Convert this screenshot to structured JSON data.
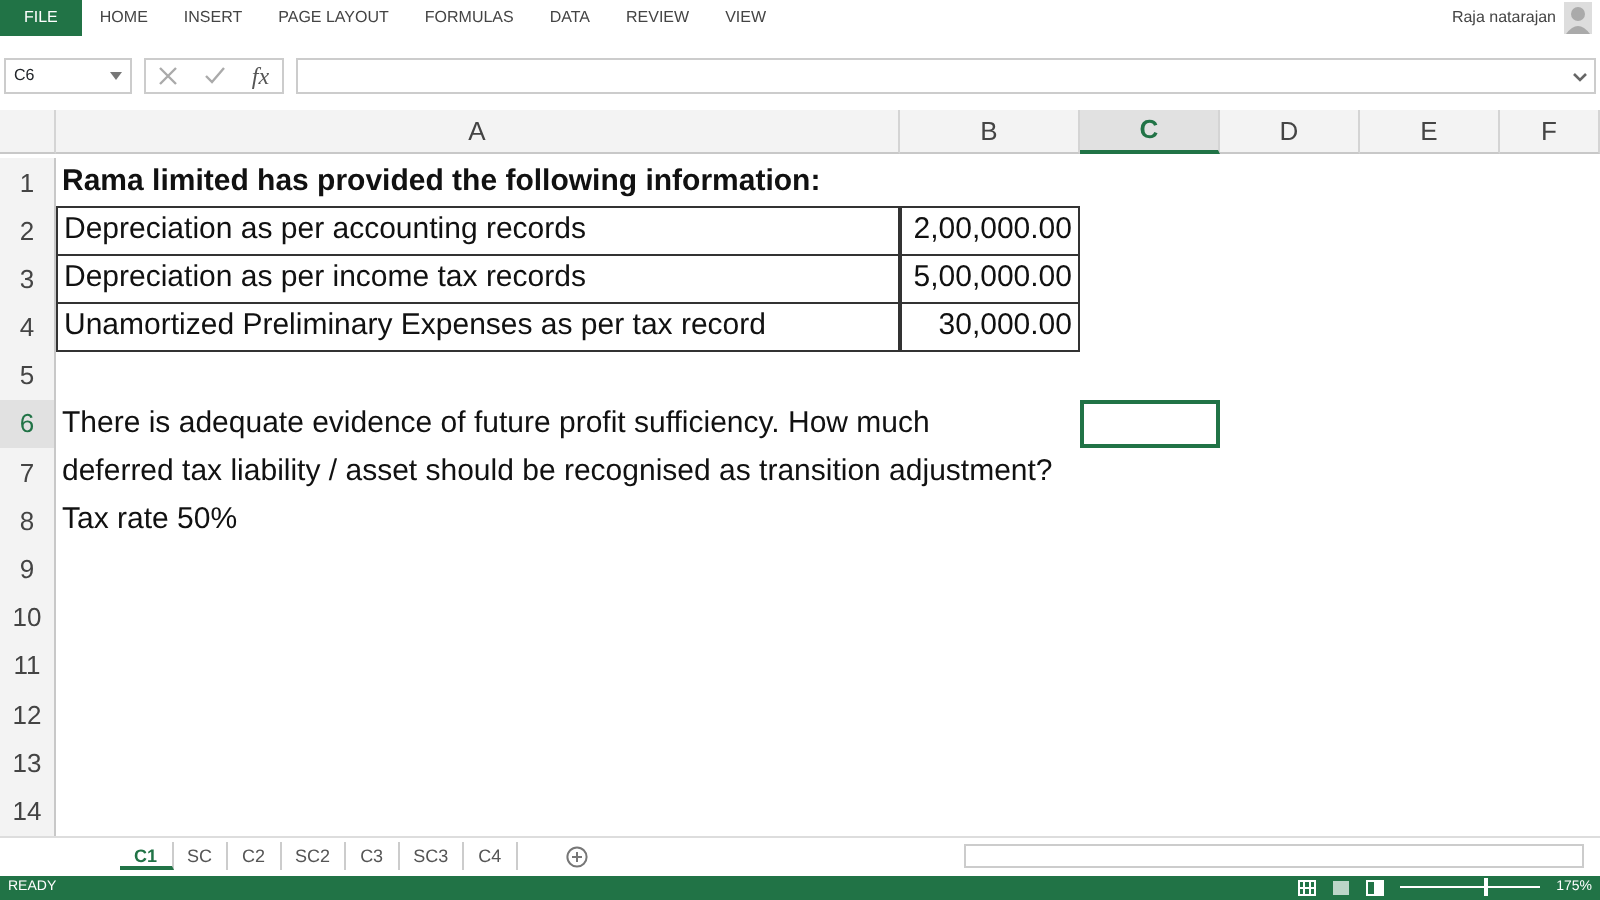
{
  "ribbon": {
    "file_tab": "FILE",
    "tabs": [
      "HOME",
      "INSERT",
      "PAGE LAYOUT",
      "FORMULAS",
      "DATA",
      "REVIEW",
      "VIEW"
    ],
    "user": "Raja natarajan"
  },
  "formula_bar": {
    "name_box": "C6",
    "fx": "fx"
  },
  "columns": [
    {
      "label": "A",
      "selected": false
    },
    {
      "label": "B",
      "selected": false
    },
    {
      "label": "C",
      "selected": true
    },
    {
      "label": "D",
      "selected": false
    },
    {
      "label": "E",
      "selected": false
    },
    {
      "label": "F",
      "selected": false
    }
  ],
  "rows": [
    {
      "number": "1",
      "selected": false,
      "kind": "heading",
      "a": "Rama limited has provided the following information:"
    },
    {
      "number": "2",
      "selected": false,
      "kind": "boxed",
      "a": "Depreciation as per accounting records",
      "b": "2,00,000.00"
    },
    {
      "number": "3",
      "selected": false,
      "kind": "boxed",
      "a": "Depreciation as per income tax records",
      "b": "5,00,000.00"
    },
    {
      "number": "4",
      "selected": false,
      "kind": "boxed",
      "a": "Unamortized Preliminary Expenses as per tax record",
      "b": "30,000.00"
    },
    {
      "number": "5",
      "selected": false,
      "kind": "empty"
    },
    {
      "number": "6",
      "selected": true,
      "kind": "text",
      "a": "There is adequate evidence of future profit sufficiency. How much"
    },
    {
      "number": "7",
      "selected": false,
      "kind": "text",
      "a": "deferred tax liability / asset should be recognised as transition adjustment?"
    },
    {
      "number": "8",
      "selected": false,
      "kind": "text",
      "a": "Tax rate 50%"
    },
    {
      "number": "9",
      "selected": false,
      "kind": "empty"
    },
    {
      "number": "10",
      "selected": false,
      "kind": "empty"
    },
    {
      "number": "11",
      "selected": false,
      "kind": "empty"
    },
    {
      "number": "12",
      "selected": false,
      "kind": "empty"
    },
    {
      "number": "13",
      "selected": false,
      "kind": "empty"
    },
    {
      "number": "14",
      "selected": false,
      "kind": "empty"
    }
  ],
  "sheet_tabs": [
    {
      "label": "C1",
      "selected": true
    },
    {
      "label": "SC",
      "selected": false
    },
    {
      "label": "C2",
      "selected": false
    },
    {
      "label": "SC2",
      "selected": false
    },
    {
      "label": "C3",
      "selected": false
    },
    {
      "label": "SC3",
      "selected": false
    },
    {
      "label": "C4",
      "selected": false
    }
  ],
  "status_bar": {
    "status": "READY",
    "level": 0.6,
    "zoom": "175%"
  }
}
